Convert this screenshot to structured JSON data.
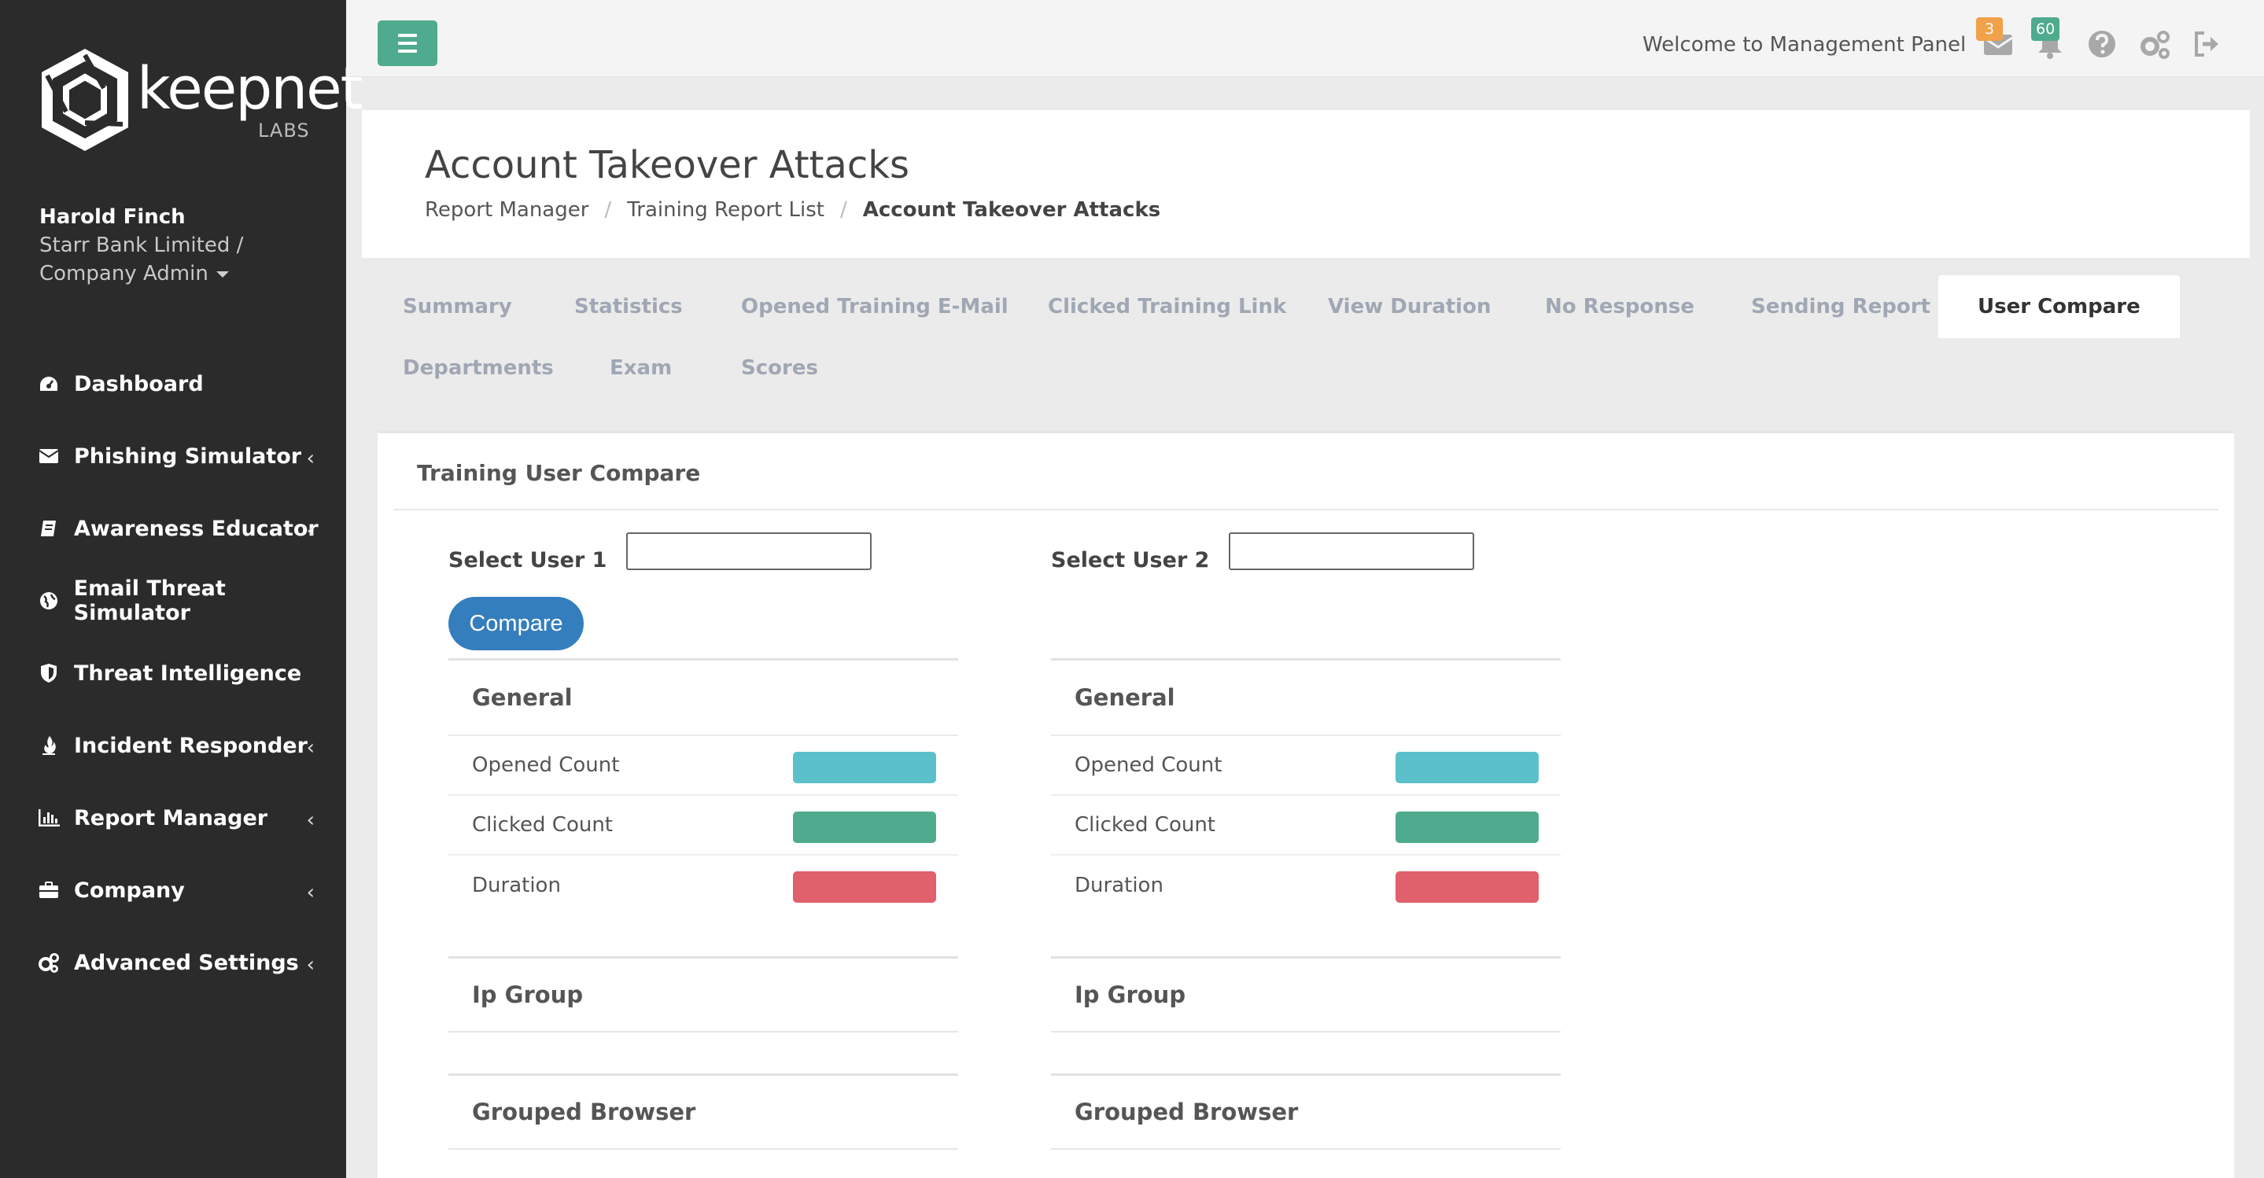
{
  "brand": {
    "logo_text": "keepnet",
    "logo_sub": "LABS"
  },
  "user": {
    "name": "Harold Finch",
    "org_line1": "Starr Bank Limited /",
    "org_line2": "Company Admin"
  },
  "sidebar": {
    "items": [
      {
        "label": "Dashboard",
        "icon": "dashboard-icon",
        "has_chevron": false
      },
      {
        "label": "Phishing Simulator",
        "icon": "envelope-icon",
        "has_chevron": true
      },
      {
        "label": "Awareness Educator",
        "icon": "book-icon",
        "has_chevron": true
      },
      {
        "label": "Email Threat Simulator",
        "icon": "globe-icon",
        "has_chevron": false
      },
      {
        "label": "Threat Intelligence",
        "icon": "shield-icon",
        "has_chevron": false
      },
      {
        "label": "Incident Responder",
        "icon": "fire-icon",
        "has_chevron": true
      },
      {
        "label": "Report Manager",
        "icon": "bar-chart-icon",
        "has_chevron": true
      },
      {
        "label": "Company",
        "icon": "briefcase-icon",
        "has_chevron": true
      },
      {
        "label": "Advanced Settings",
        "icon": "cogs-icon",
        "has_chevron": true
      }
    ]
  },
  "topbar": {
    "welcome": "Welcome to Management Panel",
    "mail_badge": "3",
    "bell_badge": "60",
    "mail_badge_color": "#f0a14a",
    "bell_badge_color": "#4fab8e"
  },
  "page": {
    "title": "Account Takeover Attacks",
    "breadcrumbs": [
      "Report Manager",
      "Training Report List",
      "Account Takeover Attacks"
    ]
  },
  "tabs": [
    "Summary",
    "Statistics",
    "Opened Training E-Mail",
    "Clicked Training Link",
    "View Duration",
    "No Response",
    "Sending Report",
    "User Compare",
    "Departments",
    "Exam",
    "Scores"
  ],
  "active_tab": "User Compare",
  "compare": {
    "title": "Training User Compare",
    "select_user1_label": "Select User 1",
    "select_user2_label": "Select User 2",
    "user1_value": "",
    "user2_value": "",
    "button_label": "Compare",
    "columns": [
      {
        "general_label": "General",
        "rows": [
          {
            "label": "Opened Count",
            "color": "#5bc0c9"
          },
          {
            "label": "Clicked Count",
            "color": "#4fab8e"
          },
          {
            "label": "Duration",
            "color": "#e0606b"
          }
        ],
        "ip_group_label": "Ip Group",
        "grouped_browser_label": "Grouped Browser"
      },
      {
        "general_label": "General",
        "rows": [
          {
            "label": "Opened Count",
            "color": "#5bc0c9"
          },
          {
            "label": "Clicked Count",
            "color": "#4fab8e"
          },
          {
            "label": "Duration",
            "color": "#e0606b"
          }
        ],
        "ip_group_label": "Ip Group",
        "grouped_browser_label": "Grouped Browser"
      }
    ]
  }
}
